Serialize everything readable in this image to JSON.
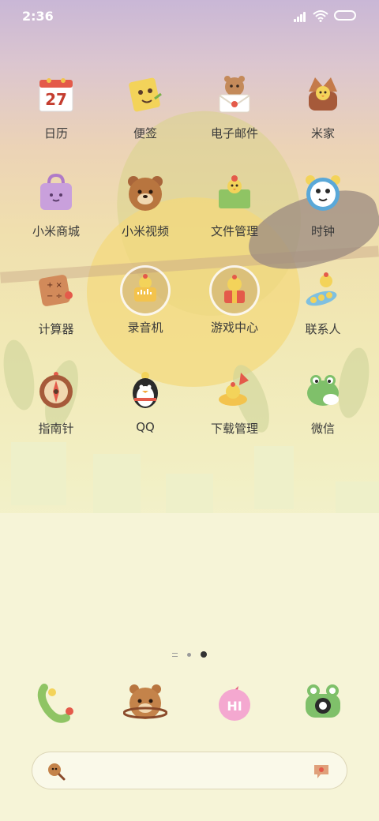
{
  "status_bar": {
    "time": "2:36"
  },
  "home": {
    "rows": [
      [
        {
          "name": "app-calendar",
          "label": "日历",
          "icon": "calendar-icon",
          "glyph": "27"
        },
        {
          "name": "app-notes",
          "label": "便签",
          "icon": "notes-icon",
          "glyph": ""
        },
        {
          "name": "app-email",
          "label": "电子邮件",
          "icon": "email-icon",
          "glyph": ""
        },
        {
          "name": "app-mijia",
          "label": "米家",
          "icon": "mijia-icon",
          "glyph": ""
        }
      ],
      [
        {
          "name": "app-mi-store",
          "label": "小米商城",
          "icon": "shopping-bag-icon",
          "glyph": ""
        },
        {
          "name": "app-mi-video",
          "label": "小米视频",
          "icon": "bear-video-icon",
          "glyph": ""
        },
        {
          "name": "app-file-manager",
          "label": "文件管理",
          "icon": "folder-icon",
          "glyph": ""
        },
        {
          "name": "app-clock",
          "label": "时钟",
          "icon": "clock-icon",
          "glyph": ""
        }
      ],
      [
        {
          "name": "app-calculator",
          "label": "计算器",
          "icon": "calculator-icon",
          "glyph": ""
        },
        {
          "name": "app-recorder",
          "label": "录音机",
          "icon": "recorder-icon",
          "glyph": ""
        },
        {
          "name": "app-game-center",
          "label": "游戏中心",
          "icon": "game-center-icon",
          "glyph": ""
        },
        {
          "name": "app-contacts",
          "label": "联系人",
          "icon": "contacts-icon",
          "glyph": ""
        }
      ],
      [
        {
          "name": "app-compass",
          "label": "指南针",
          "icon": "compass-icon",
          "glyph": ""
        },
        {
          "name": "app-qq",
          "label": "QQ",
          "icon": "penguin-icon",
          "glyph": ""
        },
        {
          "name": "app-downloads",
          "label": "下载管理",
          "icon": "download-icon",
          "glyph": ""
        },
        {
          "name": "app-wechat",
          "label": "微信",
          "icon": "frog-chat-icon",
          "glyph": ""
        }
      ]
    ],
    "page_indicator": {
      "pages": 3,
      "current": 3
    }
  },
  "dock": [
    {
      "name": "dock-phone",
      "icon": "phone-icon"
    },
    {
      "name": "dock-messages",
      "icon": "bear-planet-icon"
    },
    {
      "name": "dock-hi",
      "icon": "hi-bubble-icon",
      "text": "HI"
    },
    {
      "name": "dock-camera",
      "icon": "frog-camera-icon"
    }
  ],
  "search": {
    "left_icon": "search-icon",
    "right_icon": "voice-icon"
  },
  "colors": {
    "accent_orange": "#e9a13a",
    "sky_top": "#c9b7d6",
    "ground": "#f6f4d7",
    "label_text": "#3a3a3a"
  }
}
